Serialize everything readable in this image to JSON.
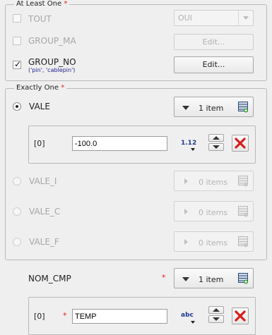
{
  "at_least_one": {
    "title": "At Least One",
    "required_mark": "*",
    "tout": {
      "label": "TOUT",
      "value": "OUI"
    },
    "group_ma": {
      "label": "GROUP_MA",
      "button": "Edit..."
    },
    "group_no": {
      "label": "GROUP_NO",
      "checked_mark": "✓",
      "value": "('pin', 'cablepin')",
      "button": "Edit..."
    }
  },
  "exactly_one": {
    "title": "Exactly One",
    "required_mark": "*",
    "vale": {
      "label": "VALE",
      "count": "1 item",
      "index": "[0]",
      "value": "-100.0",
      "type_icon": "1.12"
    },
    "vale_i": {
      "label": "VALE_I",
      "count": "0 items"
    },
    "vale_c": {
      "label": "VALE_C",
      "count": "0 items"
    },
    "vale_f": {
      "label": "VALE_F",
      "count": "0 items"
    }
  },
  "nom_cmp": {
    "label": "NOM_CMP",
    "required_mark": "*",
    "count": "1 item",
    "index": "[0]",
    "index_mark": "*",
    "value": "TEMP",
    "type_icon": "abc"
  },
  "colors": {
    "accent_red": "#e32020",
    "subtext_blue": "#1b1b8c",
    "delete_red": "#d81e1e"
  }
}
